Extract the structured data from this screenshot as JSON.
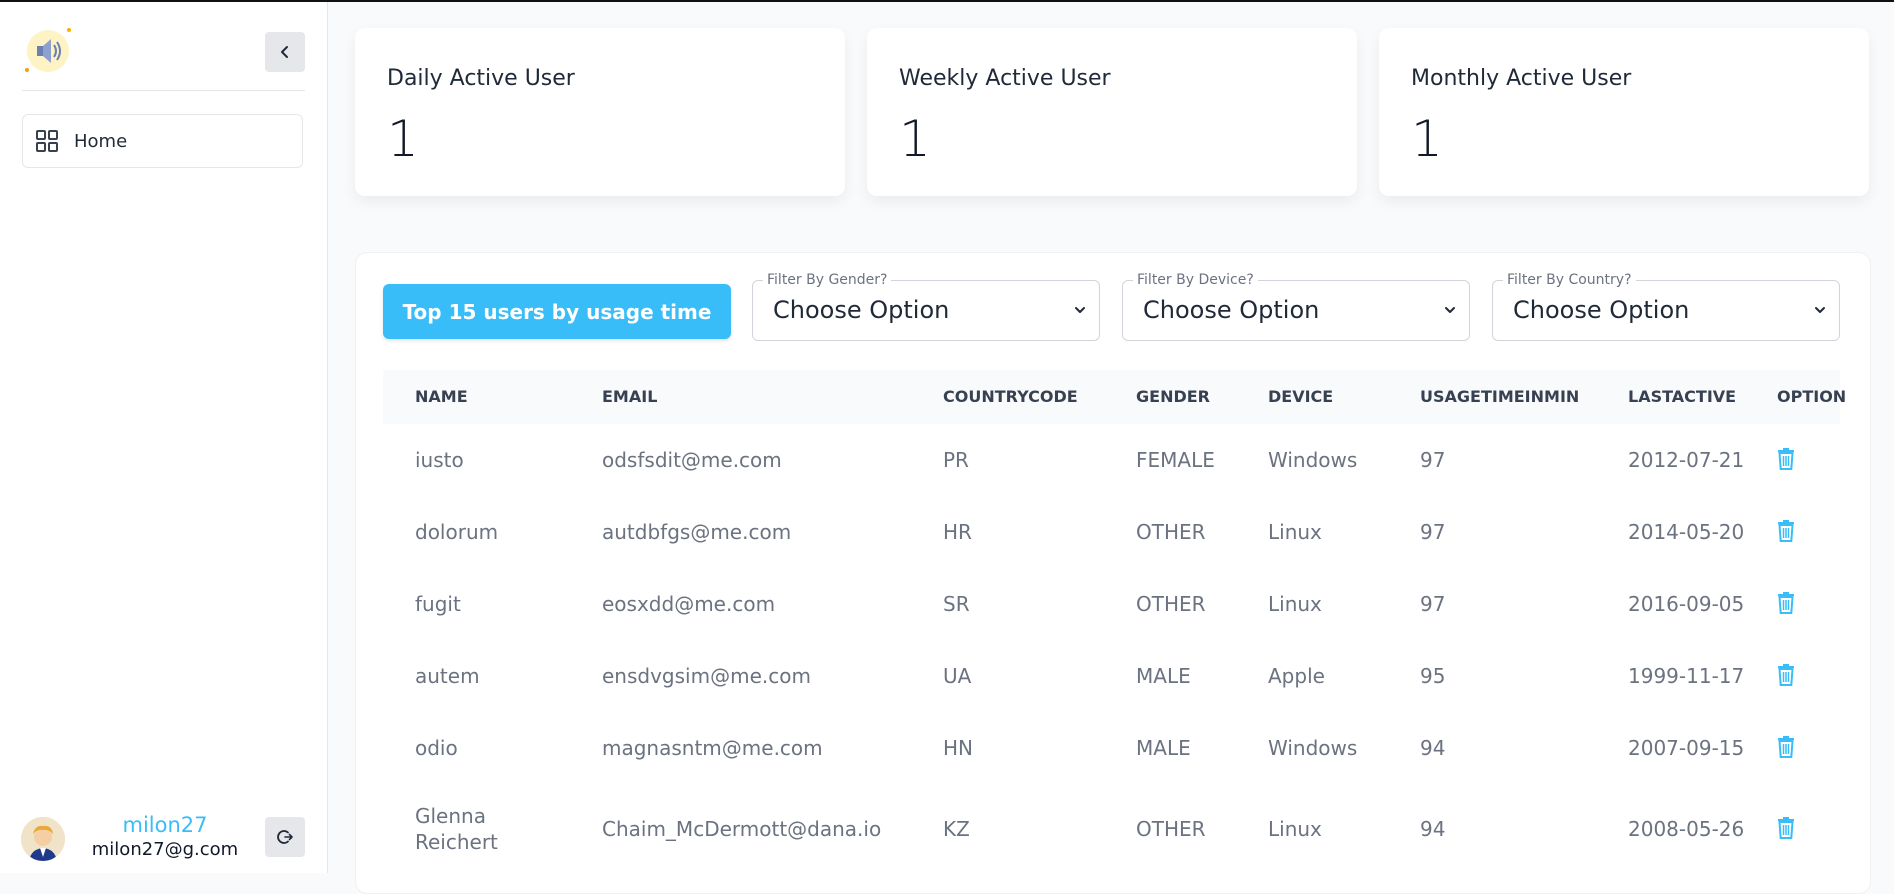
{
  "sidebar": {
    "logo_icon": "speaker-icon",
    "nav": [
      {
        "label": "Home",
        "icon": "grid-icon"
      }
    ],
    "user": {
      "name": "milon27",
      "email": "milon27@g.com"
    }
  },
  "stats": [
    {
      "title": "Daily Active User",
      "value": "1"
    },
    {
      "title": "Weekly Active User",
      "value": "1"
    },
    {
      "title": "Monthly Active User",
      "value": "1"
    }
  ],
  "toolbar": {
    "top_button_label": "Top 15 users by usage time",
    "filters": [
      {
        "label": "Filter By Gender?",
        "value": "Choose Option"
      },
      {
        "label": "Filter By Device?",
        "value": "Choose Option"
      },
      {
        "label": "Filter By Country?",
        "value": "Choose Option"
      }
    ]
  },
  "table": {
    "headers": [
      "NAME",
      "EMAIL",
      "COUNTRYCODE",
      "GENDER",
      "DEVICE",
      "USAGETIMEINMIN",
      "LASTACTIVE",
      "OPTION"
    ],
    "rows": [
      [
        "iusto",
        "odsfsdit@me.com",
        "PR",
        "FEMALE",
        "Windows",
        "97",
        "2012-07-21"
      ],
      [
        "dolorum",
        "autdbfgs@me.com",
        "HR",
        "OTHER",
        "Linux",
        "97",
        "2014-05-20"
      ],
      [
        "fugit",
        "eosxdd@me.com",
        "SR",
        "OTHER",
        "Linux",
        "97",
        "2016-09-05"
      ],
      [
        "autem",
        "ensdvgsim@me.com",
        "UA",
        "MALE",
        "Apple",
        "95",
        "1999-11-17"
      ],
      [
        "odio",
        "magnasntm@me.com",
        "HN",
        "MALE",
        "Windows",
        "94",
        "2007-09-15"
      ],
      [
        "Glenna Reichert",
        "Chaim_McDermott@dana.io",
        "KZ",
        "OTHER",
        "Linux",
        "94",
        "2008-05-26"
      ]
    ],
    "option_icon": "trash-icon"
  },
  "colors": {
    "accent": "#38bdf8",
    "text": "#1f2937",
    "muted": "#6b7280"
  }
}
